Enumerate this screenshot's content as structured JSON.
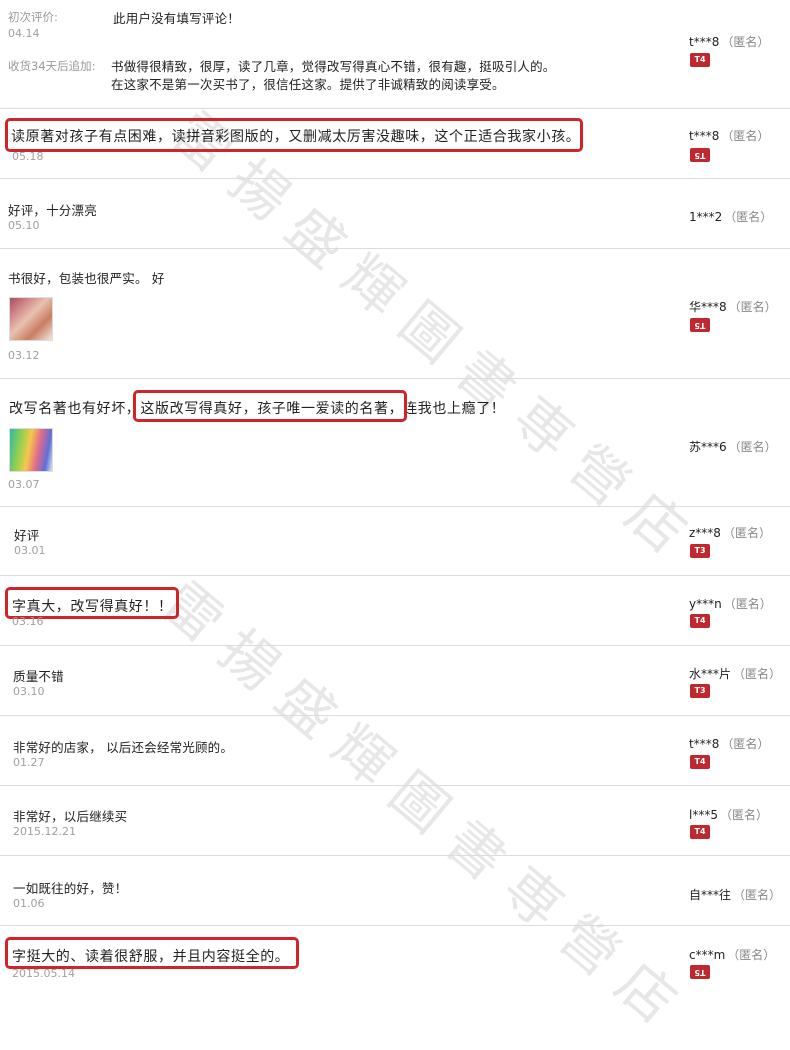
{
  "reviews": [
    {
      "initial_label": "初次评价:",
      "text": "此用户没有填写评论！",
      "date": "04.14",
      "followup_label": "收货34天后追加:",
      "followup_line1": "书做得很精致，很厚，读了几章，觉得改写得真心不错，很有趣，挺吸引人的。",
      "followup_line2": "在这家不是第一次买书了，很信任这家。提供了非诚精致的阅读享受。",
      "user": "t***8",
      "anon": "（匿名）",
      "badge": "T4"
    },
    {
      "text": "读原著对孩子有点困难，读拼音彩图版的，又删减太厉害没趣味，这个正适合我家小孩。",
      "date": "05.18",
      "user": "t***8",
      "anon": "（匿名）",
      "badge": "T5"
    },
    {
      "text": "好评，十分漂亮",
      "date": "05.10",
      "user": "1***2",
      "anon": "（匿名）"
    },
    {
      "text": "书很好，包装也很严实。 好",
      "date": "03.12",
      "user": "华***8",
      "anon": "（匿名）",
      "badge": "T5"
    },
    {
      "text": "改写名著也有好坏，这版改写得真好，孩子唯一爱读的名著，连我也上瘾了！",
      "date": "03.07",
      "user": "苏***6",
      "anon": "（匿名）"
    },
    {
      "text": "好评",
      "date": "03.01",
      "user": "z***8",
      "anon": "（匿名）",
      "badge": "T3"
    },
    {
      "text": "字真大，改写得真好！！",
      "date": "03.16",
      "user": "y***n",
      "anon": "（匿名）",
      "badge": "T4"
    },
    {
      "text": "质量不错",
      "date": "03.10",
      "user": "水***片",
      "anon": "（匿名）",
      "badge": "T3"
    },
    {
      "text": "非常好的店家， 以后还会经常光顾的。",
      "date": "01.27",
      "user": "t***8",
      "anon": "（匿名）",
      "badge": "T4"
    },
    {
      "text": "非常好，以后继续买",
      "date": "2015.12.21",
      "user": "l***5",
      "anon": "（匿名）",
      "badge": "T4"
    },
    {
      "text": "一如既往的好，赞！",
      "date": "01.06",
      "user": "自***往",
      "anon": "（匿名）"
    },
    {
      "text": "字挺大的、读着很舒服，并且内容挺全的。",
      "date": "2015.05.14",
      "user": "c***m",
      "anon": "（匿名）",
      "badge": "T5"
    }
  ],
  "watermark": "雷揚盛輝圖書専營店",
  "colors": {
    "highlight": "#d0232a",
    "badge": "#c0282f",
    "separator": "#dcdcdc"
  }
}
